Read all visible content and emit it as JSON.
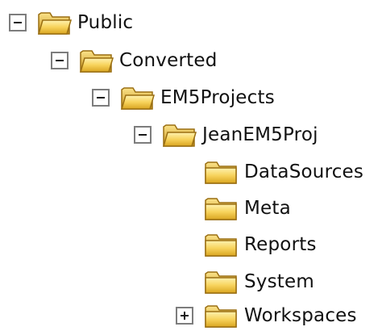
{
  "tree": {
    "nodes": [
      {
        "label": "Public",
        "toggle": "minus",
        "icon": "folder-open-icon"
      },
      {
        "label": "Converted",
        "toggle": "minus",
        "icon": "folder-open-icon"
      },
      {
        "label": "EM5Projects",
        "toggle": "minus",
        "icon": "folder-open-icon"
      },
      {
        "label": "JeanEM5Proj",
        "toggle": "minus",
        "icon": "folder-open-icon"
      },
      {
        "label": "DataSources",
        "toggle": "none",
        "icon": "folder-icon"
      },
      {
        "label": "Meta",
        "toggle": "none",
        "icon": "folder-icon"
      },
      {
        "label": "Reports",
        "toggle": "none",
        "icon": "folder-icon"
      },
      {
        "label": "System",
        "toggle": "none",
        "icon": "folder-icon"
      },
      {
        "label": "Workspaces",
        "toggle": "plus",
        "icon": "folder-icon"
      }
    ]
  },
  "colors": {
    "folder_fill": "#f7d35c",
    "folder_shade": "#d9a520",
    "folder_outline": "#9a6f12",
    "toggle_border": "#7d7d7d"
  }
}
